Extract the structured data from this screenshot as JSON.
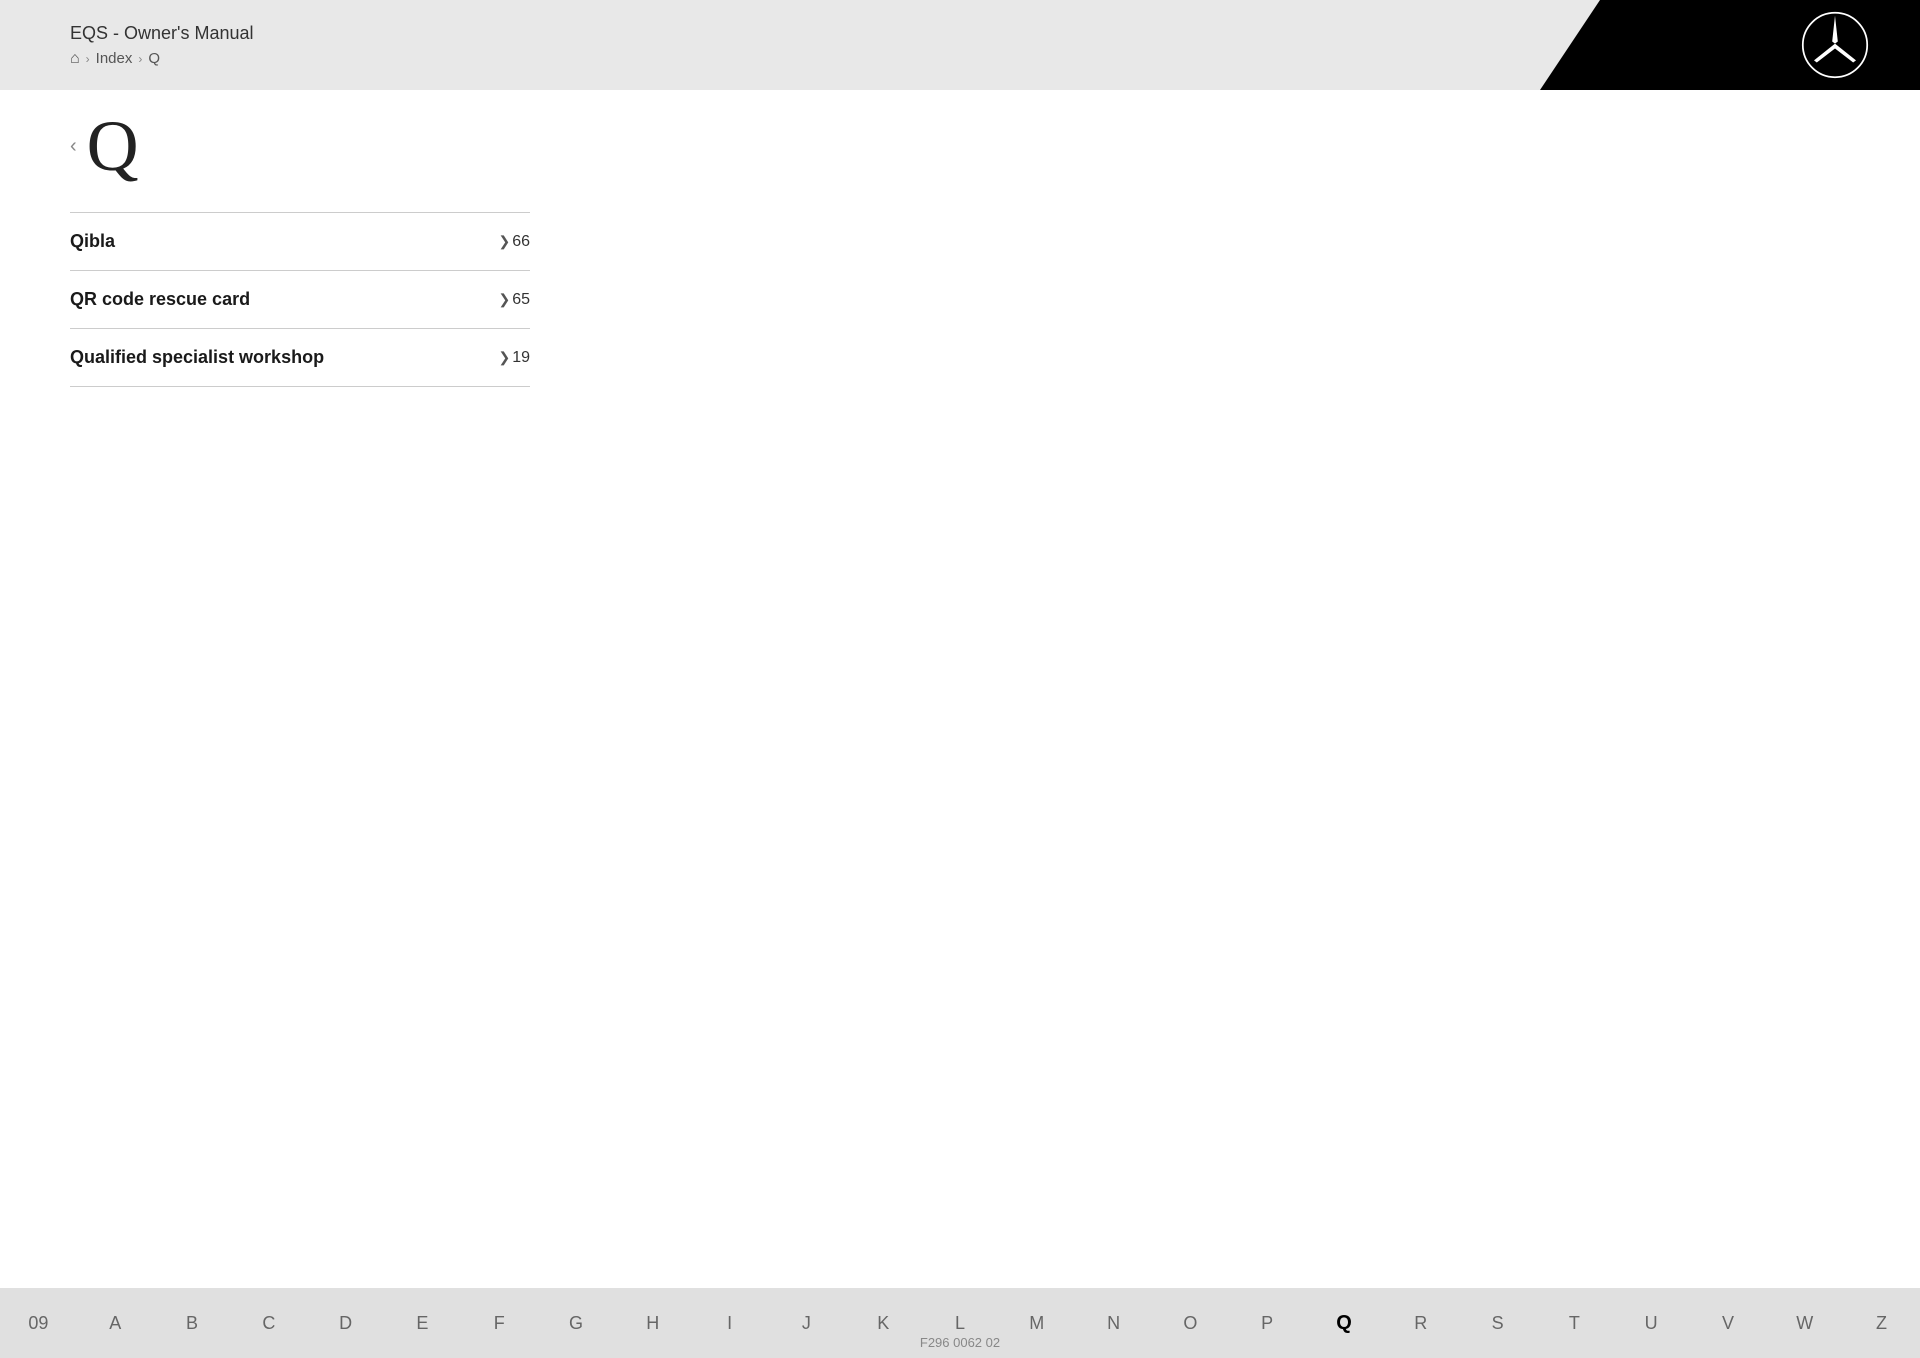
{
  "header": {
    "title": "EQS - Owner's Manual",
    "breadcrumb": {
      "home_icon": "⌂",
      "sep1": ">",
      "index_label": "Index",
      "sep2": ">",
      "current": "Q"
    }
  },
  "letter": "Q",
  "back_arrow": "‹",
  "index_entries": [
    {
      "label": "Qibla",
      "page_number": "6",
      "page_suffix": "6"
    },
    {
      "label": "QR code rescue card",
      "page_number": "6",
      "page_suffix": "5"
    },
    {
      "label": "Qualified specialist workshop",
      "page_number": "1",
      "page_suffix": "9"
    }
  ],
  "bottom_nav": {
    "items": [
      "09",
      "A",
      "B",
      "C",
      "D",
      "E",
      "F",
      "G",
      "H",
      "I",
      "J",
      "K",
      "L",
      "M",
      "N",
      "O",
      "P",
      "Q",
      "R",
      "S",
      "T",
      "U",
      "V",
      "W",
      "Z"
    ],
    "active": "Q"
  },
  "footer_code": "F296 0062 02"
}
